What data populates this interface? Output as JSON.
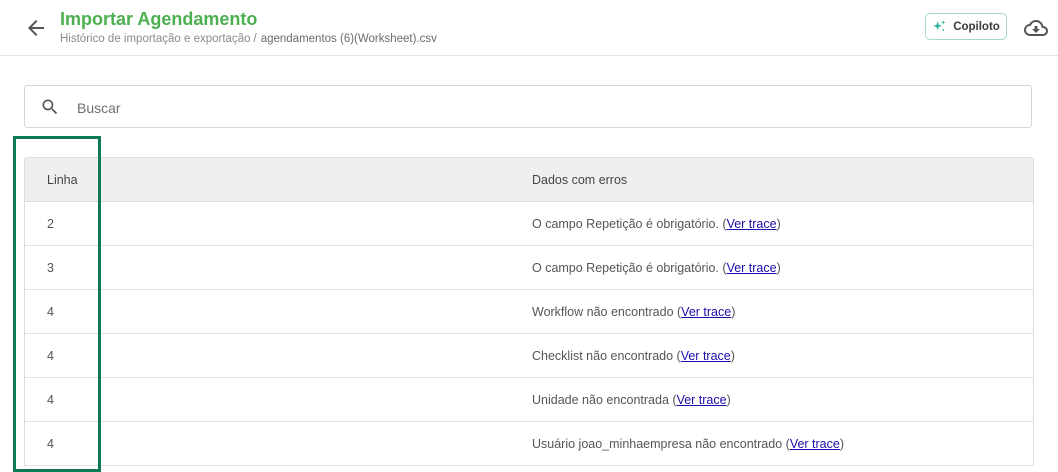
{
  "header": {
    "title": "Importar Agendamento",
    "breadcrumb": {
      "parent": "Histórico de importação e exportação",
      "separator": "/",
      "current": "agendamentos (6)(Worksheet).csv"
    },
    "copilot_label": "Copiloto",
    "icons": {
      "back": "arrow-left-icon",
      "copilot": "sparkles-icon",
      "download": "cloud-download-icon"
    }
  },
  "search": {
    "placeholder": "Buscar",
    "value": "",
    "icon": "search-icon"
  },
  "table": {
    "columns": [
      "Linha",
      "Dados com erros"
    ],
    "link_label": "Ver trace",
    "rows": [
      {
        "line": "2",
        "error": "O campo Repetição é obrigatório."
      },
      {
        "line": "3",
        "error": "O campo Repetição é obrigatório."
      },
      {
        "line": "4",
        "error": "Workflow não encontrado"
      },
      {
        "line": "4",
        "error": "Checklist não encontrado"
      },
      {
        "line": "4",
        "error": "Unidade não encontrada"
      },
      {
        "line": "4",
        "error": "Usuário joao_minhaempresa não encontrado"
      }
    ]
  },
  "colors": {
    "title": "#4caf50",
    "highlight": "#0b7a55",
    "copilot_border": "#a6d8cf",
    "copilot_icon": "#2bb39a",
    "link": "#1a0dab"
  }
}
